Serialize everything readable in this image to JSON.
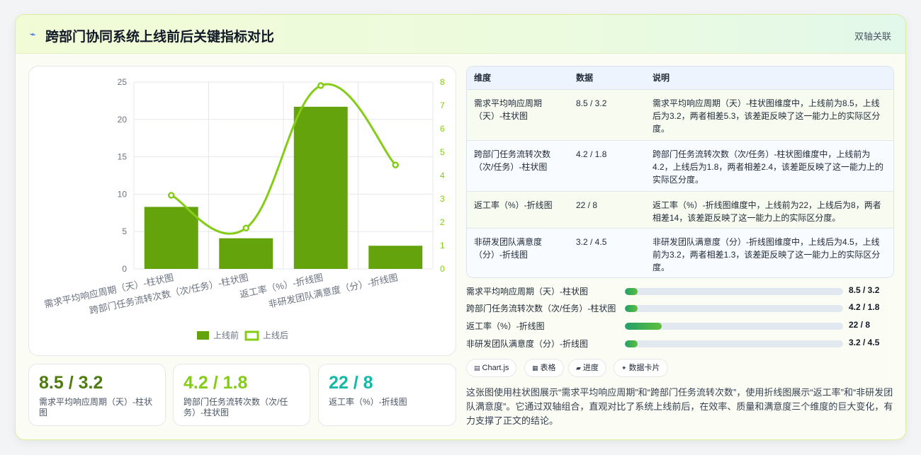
{
  "header": {
    "icon": "chart-line-icon",
    "title": "跨部门协同系统上线前后关键指标对比",
    "badge": "双轴关联"
  },
  "chart_data": {
    "type": "bar",
    "categories": [
      "需求平均响应周期（天）-柱状图",
      "跨部门任务流转次数（次/任务）-柱状图",
      "返工率（%）-折线图",
      "非研发团队满意度（分）-折线图"
    ],
    "series": [
      {
        "name": "上线前",
        "type": "bar",
        "axis": "left",
        "values": [
          8.3,
          4.1,
          21.7,
          3.1
        ],
        "color": "#65a30d"
      },
      {
        "name": "上线后",
        "type": "line",
        "axis": "right",
        "values": [
          3.15,
          1.75,
          7.85,
          4.45
        ],
        "color": "#84cc16"
      }
    ],
    "left_axis": {
      "min": 0,
      "max": 25,
      "ticks": [
        "0",
        "5",
        "10",
        "15",
        "20",
        "25"
      ]
    },
    "right_axis": {
      "min": 0,
      "max": 8,
      "ticks": [
        "0",
        "1",
        "2",
        "3",
        "4",
        "5",
        "6",
        "7",
        "8"
      ]
    },
    "grid": true,
    "legend": "bottom"
  },
  "kpis": [
    {
      "value": "8.5 / 3.2",
      "label": "需求平均响应周期（天）-柱状图",
      "color": "#4d7c0f"
    },
    {
      "value": "4.2 / 1.8",
      "label": "跨部门任务流转次数（次/任务）-柱状图",
      "color": "#84cc16"
    },
    {
      "value": "22 / 8",
      "label": "返工率（%）-折线图",
      "color": "#14b8a6"
    }
  ],
  "table": {
    "headers": [
      "维度",
      "数据",
      "说明"
    ],
    "rows": [
      {
        "dim": "需求平均响应周期（天）-柱状图",
        "data": "8.5 / 3.2",
        "desc": "需求平均响应周期（天）-柱状图维度中，上线前为8.5，上线后为3.2，两者相差5.3，该差距反映了这一能力上的实际区分度。"
      },
      {
        "dim": "跨部门任务流转次数（次/任务）-柱状图",
        "data": "4.2 / 1.8",
        "desc": "跨部门任务流转次数（次/任务）-柱状图维度中，上线前为4.2，上线后为1.8，两者相差2.4，该差距反映了这一能力上的实际区分度。"
      },
      {
        "dim": "返工率（%）-折线图",
        "data": "22 / 8",
        "desc": "返工率（%）-折线图维度中，上线前为22，上线后为8，两者相差14，该差距反映了这一能力上的实际区分度。"
      },
      {
        "dim": "非研发团队满意度（分）-折线图",
        "data": "3.2 / 4.5",
        "desc": "非研发团队满意度（分）-折线图维度中，上线后为4.5，上线前为3.2，两者相差1.3，该差距反映了这一能力上的实际区分度。"
      }
    ]
  },
  "progress": [
    {
      "label": "需求平均响应周期（天）-柱状图",
      "value": "8.5 / 3.2",
      "fill": 0.06
    },
    {
      "label": "跨部门任务流转次数（次/任务）-柱状图",
      "value": "4.2 / 1.8",
      "fill": 0.06
    },
    {
      "label": "返工率（%）-折线图",
      "value": "22 / 8",
      "fill": 0.17
    },
    {
      "label": "非研发团队满意度（分）-折线图",
      "value": "3.2 / 4.5",
      "fill": 0.06
    }
  ],
  "chips": [
    {
      "icon": "chart-icon",
      "glyph": "▤",
      "label": "Chart.js"
    },
    {
      "icon": "table-icon",
      "glyph": "▦",
      "label": "表格"
    },
    {
      "icon": "progress-icon",
      "glyph": "▰",
      "label": "进度"
    },
    {
      "icon": "card-icon",
      "glyph": "✦",
      "label": "数据卡片"
    }
  ],
  "summary": "这张图使用柱状图展示“需求平均响应周期”和“跨部门任务流转次数”，使用折线图展示“返工率”和“非研发团队满意度”。它通过双轴组合，直观对比了系统上线前后，在效率、质量和满意度三个维度的巨大变化，有力支撑了正文的结论。"
}
